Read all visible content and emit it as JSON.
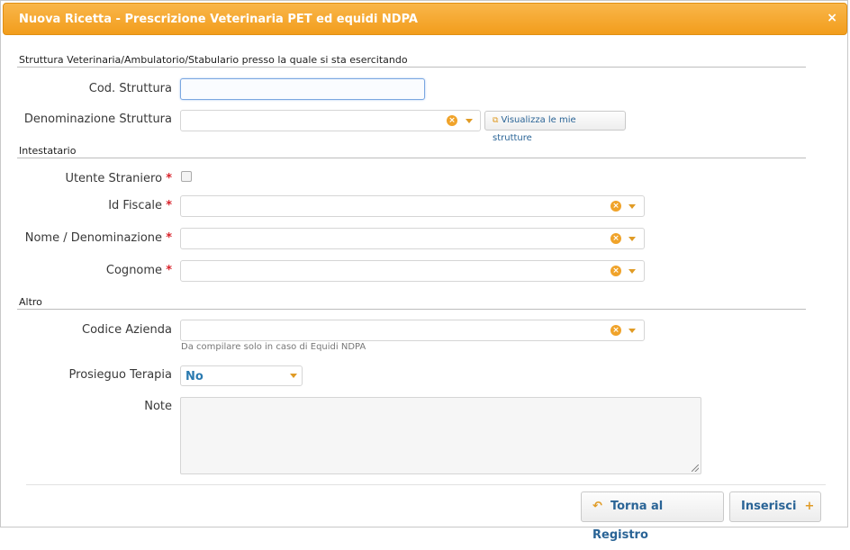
{
  "dialog": {
    "title": "Nuova Ricetta - Prescrizione Veterinaria PET ed equidi NDPA",
    "close_glyph": "×"
  },
  "sections": {
    "struttura": "Struttura Veterinaria/Ambulatorio/Stabulario presso la quale si sta esercitando",
    "intestatario": "Intestatario",
    "altro": "Altro"
  },
  "fields": {
    "cod_struttura": {
      "label": "Cod. Struttura",
      "value": ""
    },
    "denominazione_struttura": {
      "label": "Denominazione Struttura",
      "value": ""
    },
    "visualizza_btn": "Visualizza le mie strutture",
    "utente_straniero": {
      "label": "Utente Straniero",
      "required": "*",
      "checked": false
    },
    "id_fiscale": {
      "label": "Id Fiscale",
      "required": "*",
      "value": ""
    },
    "nome": {
      "label": "Nome / Denominazione",
      "required": "*",
      "value": ""
    },
    "cognome": {
      "label": "Cognome",
      "required": "*",
      "value": ""
    },
    "codice_azienda": {
      "label": "Codice Azienda",
      "value": "",
      "hint": "Da compilare solo in caso di Equidi NDPA"
    },
    "prosieguo_terapia": {
      "label": "Prosieguo Terapia",
      "value": "No"
    },
    "note": {
      "label": "Note",
      "value": ""
    }
  },
  "footer": {
    "back_label": "Torna al Registro",
    "back_icon": "↶",
    "insert_label": "Inserisci",
    "insert_icon": "+"
  },
  "icons": {
    "clear": "×",
    "external": "⧉"
  },
  "colors": {
    "titlebar": "#f29d1c",
    "required": "#d9242c",
    "accent_icon": "#e09b25",
    "link": "#2a6496"
  }
}
